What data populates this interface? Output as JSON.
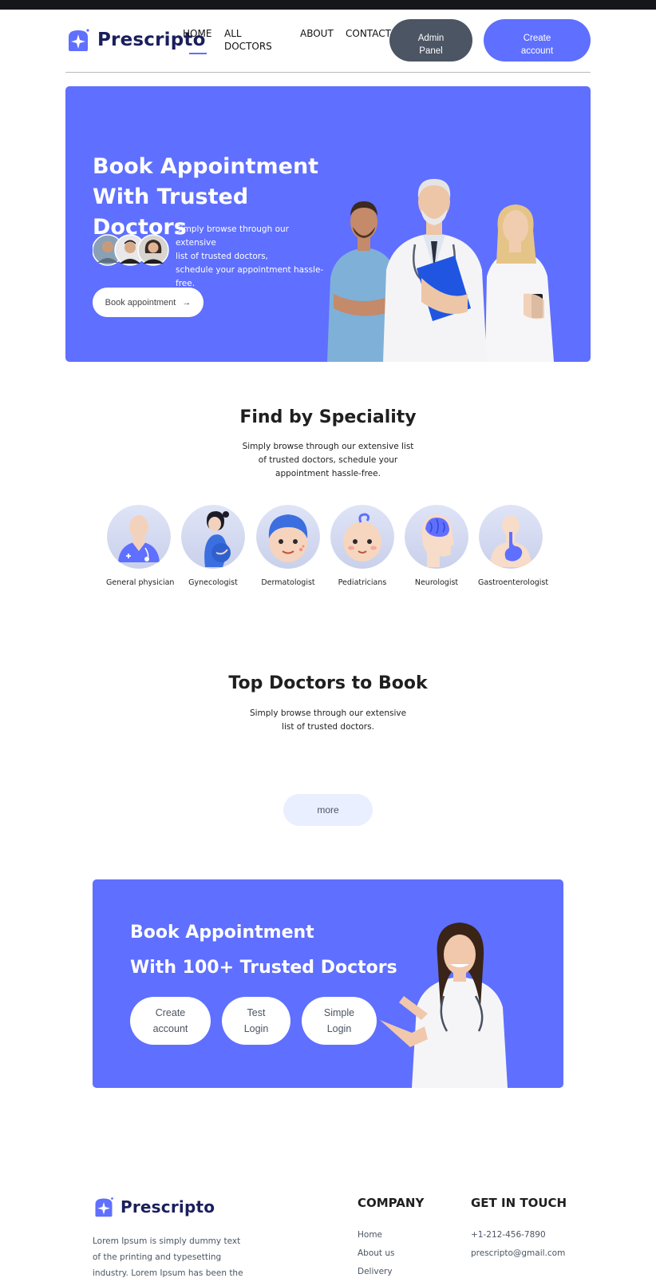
{
  "brand": {
    "name": "Prescripto",
    "accent": "#5f6fff",
    "dark": "#1a1f5c"
  },
  "nav": {
    "home": "HOME",
    "all_doctors_1": "ALL",
    "all_doctors_2": "DOCTORS",
    "about": "ABOUT",
    "contact": "CONTACT",
    "admin_1": "Admin",
    "admin_2": "Panel",
    "create_1": "Create",
    "create_2": "account"
  },
  "hero": {
    "title_1": "Book Appointment",
    "title_2": "With Trusted Doctors",
    "desc_1": "Simply browse through our extensive",
    "desc_2": "list of trusted doctors,",
    "desc_3": "schedule your appointment hassle-",
    "desc_4": "free.",
    "button": "Book appointment",
    "button_icon": "arrow-right-icon"
  },
  "speciality": {
    "title": "Find by Speciality",
    "desc_1": "Simply browse through our extensive list",
    "desc_2": "of trusted doctors, schedule your",
    "desc_3": "appointment hassle-free.",
    "items": [
      {
        "label": "General physician"
      },
      {
        "label": "Gynecologist"
      },
      {
        "label": "Dermatologist"
      },
      {
        "label": "Pediatricians"
      },
      {
        "label": "Neurologist"
      },
      {
        "label": "Gastroenterologist"
      }
    ]
  },
  "top_doctors": {
    "title": "Top Doctors to Book",
    "desc_1": "Simply browse through our extensive",
    "desc_2": "list of trusted doctors.",
    "more": "more"
  },
  "banner": {
    "title_1": "Book Appointment",
    "title_2": "With 100+ Trusted Doctors",
    "btn1_1": "Create",
    "btn1_2": "account",
    "btn2_1": "Test",
    "btn2_2": "Login",
    "btn3_1": "Simple",
    "btn3_2": "Login"
  },
  "footer": {
    "desc_1": "Lorem Ipsum is simply dummy text",
    "desc_2": "of the printing and typesetting",
    "desc_3": "industry. Lorem Ipsum has been the",
    "company_heading": "COMPANY",
    "company_links": [
      "Home",
      "About us",
      "Delivery"
    ],
    "contact_heading": "GET IN TOUCH",
    "phone": "+1-212-456-7890",
    "email": "prescripto@gmail.com"
  }
}
